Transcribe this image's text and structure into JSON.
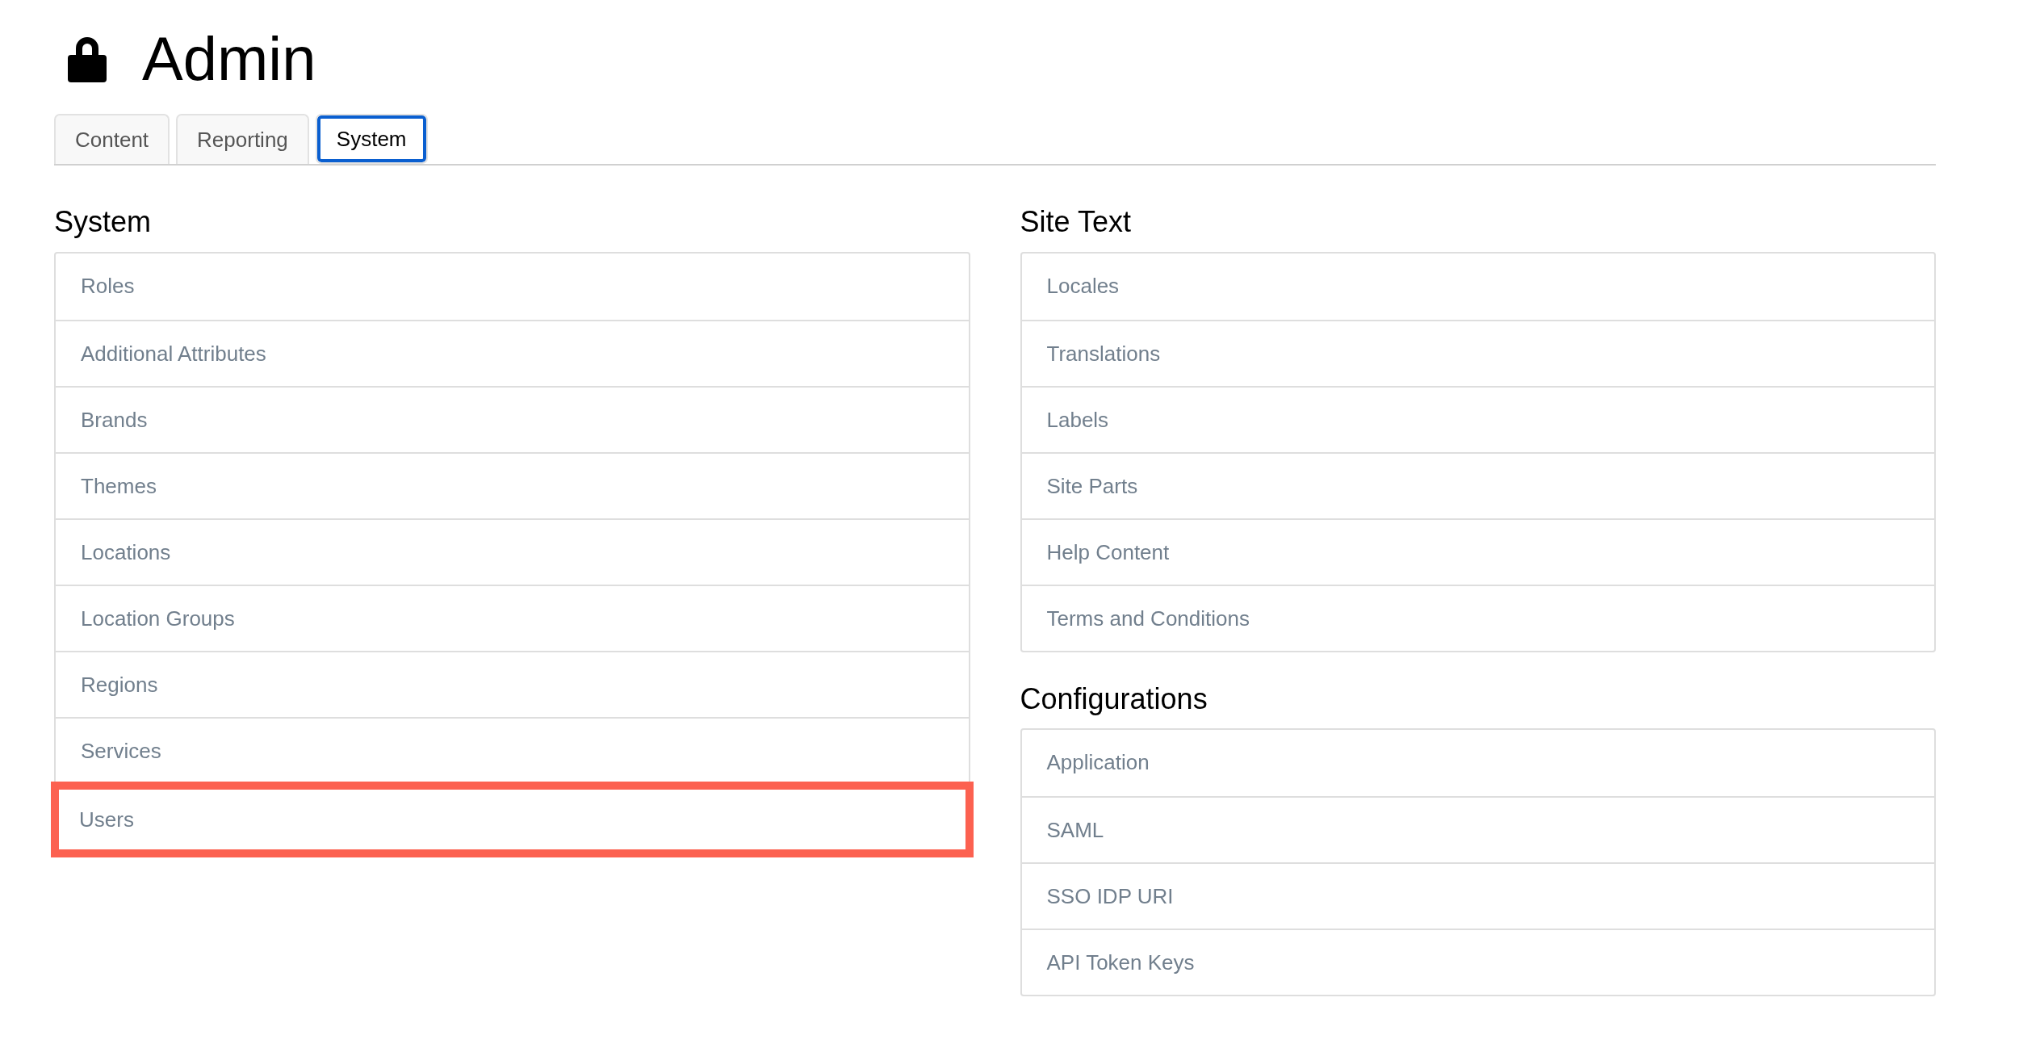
{
  "page": {
    "title": "Admin"
  },
  "tabs": [
    {
      "label": "Content",
      "selected": false
    },
    {
      "label": "Reporting",
      "selected": false
    },
    {
      "label": "System",
      "selected": true
    }
  ],
  "columns": [
    [
      {
        "heading": "System",
        "items": [
          {
            "label": "Roles",
            "highlighted": false
          },
          {
            "label": "Additional Attributes",
            "highlighted": false
          },
          {
            "label": "Brands",
            "highlighted": false
          },
          {
            "label": "Themes",
            "highlighted": false
          },
          {
            "label": "Locations",
            "highlighted": false
          },
          {
            "label": "Location Groups",
            "highlighted": false
          },
          {
            "label": "Regions",
            "highlighted": false
          },
          {
            "label": "Services",
            "highlighted": false
          },
          {
            "label": "Users",
            "highlighted": true
          }
        ]
      }
    ],
    [
      {
        "heading": "Site Text",
        "items": [
          {
            "label": "Locales",
            "highlighted": false
          },
          {
            "label": "Translations",
            "highlighted": false
          },
          {
            "label": "Labels",
            "highlighted": false
          },
          {
            "label": "Site Parts",
            "highlighted": false
          },
          {
            "label": "Help Content",
            "highlighted": false
          },
          {
            "label": "Terms and Conditions",
            "highlighted": false
          }
        ]
      },
      {
        "heading": "Configurations",
        "items": [
          {
            "label": "Application",
            "highlighted": false
          },
          {
            "label": "SAML",
            "highlighted": false
          },
          {
            "label": "SSO IDP URI",
            "highlighted": false
          },
          {
            "label": "API Token Keys",
            "highlighted": false
          }
        ]
      }
    ]
  ]
}
